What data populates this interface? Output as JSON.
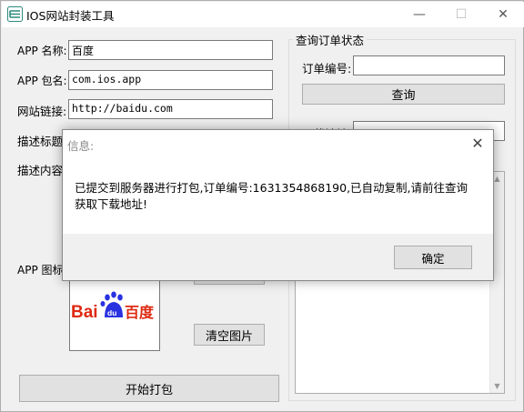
{
  "window": {
    "title": "IOS网站封装工具",
    "controls": {
      "minimize": "—",
      "maximize": "☐",
      "close": "✕"
    }
  },
  "form": {
    "app_name_label": "APP 名称:",
    "app_name_value": "百度",
    "package_label": "APP 包名:",
    "package_value": "com.ios.app",
    "url_label": "网站链接:",
    "url_value": "http://baidu.com",
    "desc_title_label": "描述标题",
    "desc_content_label": "描述内容",
    "icon_label": "APP 图标",
    "clear_image_label": "清空图片",
    "start_pack_label": "开始打包",
    "icon_brand": {
      "bai": "Bai",
      "du_paw": "du",
      "chinese": "百度",
      "red": "#de2910",
      "blue": "#2932e1"
    }
  },
  "query": {
    "group_title": "查询订单状态",
    "order_label": "订单编号:",
    "order_value": "",
    "query_button": "查询",
    "download_label": "下载地址:"
  },
  "dialog": {
    "title": "信息:",
    "close": "✕",
    "message": "已提交到服务器进行打包,订单编号:1631354868190,已自动复制,请前往查询获取下载地址!",
    "ok_label": "确定"
  }
}
